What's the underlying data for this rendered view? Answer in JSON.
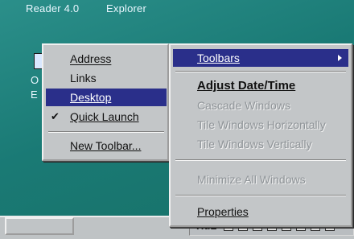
{
  "desktop": {
    "top_icons": [
      "Reader 4.0",
      "Explorer"
    ],
    "left_clip_1": "O",
    "left_clip_2": "E"
  },
  "submenu": {
    "items": [
      {
        "label": "Address"
      },
      {
        "label": "Links"
      },
      {
        "label": "Desktop",
        "highlighted": true
      },
      {
        "label": "Quick Launch",
        "checked": true
      },
      {
        "label": "New Toolbar..."
      }
    ]
  },
  "context_menu": {
    "toolbars_label": "Toolbars",
    "adjust_date_time_label": "Adjust Date/Time",
    "cascade_label": "Cascade Windows",
    "tile_h_label": "Tile Windows Horizontally",
    "tile_v_label": "Tile Windows Vertically",
    "minimize_all_label": "Minimize All Windows",
    "properties_label": "Properties"
  },
  "tray": {
    "clock_text": "HuL"
  },
  "colors": {
    "menu_bg": "#c3c6c8",
    "highlight": "#2a2f8a",
    "desktop": "#1f7f7a"
  }
}
